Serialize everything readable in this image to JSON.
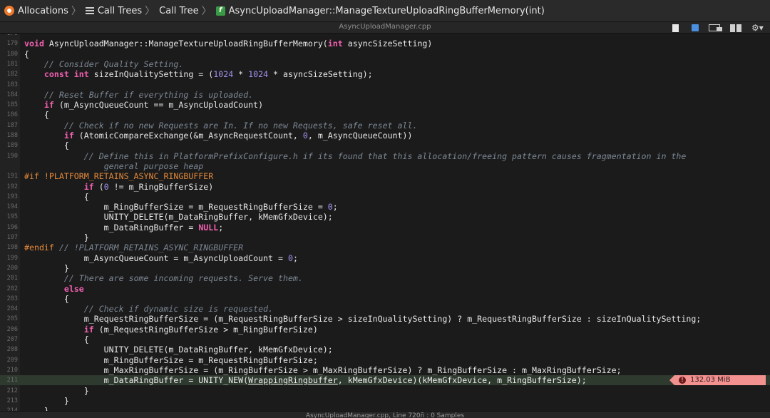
{
  "breadcrumbs": [
    {
      "label": "Allocations",
      "icon": "allocations-icon"
    },
    {
      "label": "Call Trees",
      "icon": "list-icon"
    },
    {
      "label": "Call Tree",
      "icon": ""
    },
    {
      "label": "AsyncUploadManager::ManageTextureUploadRingBufferMemory(int)",
      "icon": "function-icon"
    }
  ],
  "toolbar": {
    "filename": "AsyncUploadManager.cpp",
    "icons": [
      "document-icon",
      "color-picker-icon",
      "window-icon",
      "split-view-icon",
      "gear-icon"
    ]
  },
  "code": {
    "highlight_color": "#2f3a2e",
    "lines": [
      {
        "n": "178",
        "tokens": []
      },
      {
        "n": "179",
        "tokens": [
          [
            "kw",
            "void"
          ],
          [
            "t",
            " AsyncUploadManager::ManageTextureUploadRingBufferMemory("
          ],
          [
            "kw",
            "int"
          ],
          [
            "t",
            " asyncSizeSetting)"
          ]
        ]
      },
      {
        "n": "180",
        "tokens": [
          [
            "t",
            "{"
          ]
        ]
      },
      {
        "n": "181",
        "tokens": [
          [
            "t",
            "    "
          ],
          [
            "cm",
            "// Consider Quality Setting."
          ]
        ]
      },
      {
        "n": "182",
        "tokens": [
          [
            "t",
            "    "
          ],
          [
            "kw",
            "const int"
          ],
          [
            "t",
            " sizeInQualitySetting = ("
          ],
          [
            "num",
            "1024"
          ],
          [
            "t",
            " * "
          ],
          [
            "num",
            "1024"
          ],
          [
            "t",
            " * asyncSizeSetting);"
          ]
        ]
      },
      {
        "n": "183",
        "tokens": []
      },
      {
        "n": "184",
        "tokens": [
          [
            "t",
            "    "
          ],
          [
            "cm",
            "// Reset Buffer if everything is uploaded."
          ]
        ]
      },
      {
        "n": "185",
        "tokens": [
          [
            "t",
            "    "
          ],
          [
            "kw",
            "if"
          ],
          [
            "t",
            " (m_AsyncQueueCount == m_AsyncUploadCount)"
          ]
        ]
      },
      {
        "n": "186",
        "tokens": [
          [
            "t",
            "    {"
          ]
        ]
      },
      {
        "n": "187",
        "tokens": [
          [
            "t",
            "        "
          ],
          [
            "cm",
            "// Check if no new Requests are In. If no new Requests, safe reset all."
          ]
        ]
      },
      {
        "n": "188",
        "tokens": [
          [
            "t",
            "        "
          ],
          [
            "kw",
            "if"
          ],
          [
            "t",
            " (AtomicCompareExchange(&m_AsyncRequestCount, "
          ],
          [
            "num",
            "0"
          ],
          [
            "t",
            ", m_AsyncQueueCount))"
          ]
        ]
      },
      {
        "n": "189",
        "tokens": [
          [
            "t",
            "        {"
          ]
        ]
      },
      {
        "n": "190",
        "tokens": [
          [
            "t",
            "            "
          ],
          [
            "cm",
            "// Define this in PlatformPrefixConfigure.h if its found that this allocation/freeing pattern causes fragmentation in the"
          ]
        ]
      },
      {
        "n": "",
        "tokens": [
          [
            "t",
            "                "
          ],
          [
            "cm",
            "general purpose heap"
          ]
        ]
      },
      {
        "n": "191",
        "tokens": [
          [
            "pp",
            "#if !PLATFORM_RETAINS_ASYNC_RINGBUFFER"
          ]
        ]
      },
      {
        "n": "192",
        "tokens": [
          [
            "t",
            "            "
          ],
          [
            "kw",
            "if"
          ],
          [
            "t",
            " ("
          ],
          [
            "num",
            "0"
          ],
          [
            "t",
            " != m_RingBufferSize)"
          ]
        ]
      },
      {
        "n": "193",
        "tokens": [
          [
            "t",
            "            {"
          ]
        ]
      },
      {
        "n": "194",
        "tokens": [
          [
            "t",
            "                m_RingBufferSize = m_RequestRingBufferSize = "
          ],
          [
            "num",
            "0"
          ],
          [
            "t",
            ";"
          ]
        ]
      },
      {
        "n": "195",
        "tokens": [
          [
            "t",
            "                UNITY_DELETE(m_DataRingBuffer, kMemGfxDevice);"
          ]
        ]
      },
      {
        "n": "196",
        "tokens": [
          [
            "t",
            "                m_DataRingBuffer = "
          ],
          [
            "kw",
            "NULL"
          ],
          [
            "t",
            ";"
          ]
        ]
      },
      {
        "n": "197",
        "tokens": [
          [
            "t",
            "            }"
          ]
        ]
      },
      {
        "n": "198",
        "tokens": [
          [
            "pp",
            "#endif"
          ],
          [
            "t",
            " "
          ],
          [
            "cm",
            "// !PLATFORM_RETAINS_ASYNC_RINGBUFFER"
          ]
        ]
      },
      {
        "n": "199",
        "tokens": [
          [
            "t",
            "            m_AsyncQueueCount = m_AsyncUploadCount = "
          ],
          [
            "num",
            "0"
          ],
          [
            "t",
            ";"
          ]
        ]
      },
      {
        "n": "200",
        "tokens": [
          [
            "t",
            "        }"
          ]
        ]
      },
      {
        "n": "201",
        "tokens": [
          [
            "t",
            "        "
          ],
          [
            "cm",
            "// There are some incoming requests. Serve them."
          ]
        ]
      },
      {
        "n": "202",
        "tokens": [
          [
            "t",
            "        "
          ],
          [
            "kw",
            "else"
          ]
        ]
      },
      {
        "n": "203",
        "tokens": [
          [
            "t",
            "        {"
          ]
        ]
      },
      {
        "n": "204",
        "tokens": [
          [
            "t",
            "            "
          ],
          [
            "cm",
            "// Check if dynamic size is requested."
          ]
        ]
      },
      {
        "n": "205",
        "tokens": [
          [
            "t",
            "            m_RequestRingBufferSize = (m_RequestRingBufferSize > sizeInQualitySetting) ? m_RequestRingBufferSize : sizeInQualitySetting;"
          ]
        ]
      },
      {
        "n": "206",
        "tokens": [
          [
            "t",
            "            "
          ],
          [
            "kw",
            "if"
          ],
          [
            "t",
            " (m_RequestRingBufferSize > m_RingBufferSize)"
          ]
        ]
      },
      {
        "n": "207",
        "tokens": [
          [
            "t",
            "            {"
          ]
        ]
      },
      {
        "n": "208",
        "tokens": [
          [
            "t",
            "                UNITY_DELETE(m_DataRingBuffer, kMemGfxDevice);"
          ]
        ]
      },
      {
        "n": "209",
        "tokens": [
          [
            "t",
            "                m_RingBufferSize = m_RequestRingBufferSize;"
          ]
        ]
      },
      {
        "n": "210",
        "tokens": [
          [
            "t",
            "                m_MaxRingBufferSize = (m_RingBufferSize > m_MaxRingBufferSize) ? m_RingBufferSize : m_MaxRingBufferSize;"
          ]
        ]
      },
      {
        "n": "211",
        "highlight": true,
        "badge": "132.03 MiB",
        "tokens": [
          [
            "t",
            "                m_DataRingBuffer = UNITY_NEW("
          ],
          [
            "ul",
            "WrappingRingbuffer"
          ],
          [
            "t",
            ", kMemGfxDevice)(kMemGfxDevice, m_RingBufferSize);"
          ]
        ]
      },
      {
        "n": "212",
        "tokens": [
          [
            "t",
            "            }"
          ]
        ]
      },
      {
        "n": "213",
        "tokens": [
          [
            "t",
            "        }"
          ]
        ]
      },
      {
        "n": "214",
        "tokens": [
          [
            "t",
            "    }"
          ]
        ]
      }
    ]
  },
  "statusbar": {
    "text": "AsyncUploadManager.cpp, Line 720ñ : 0 Samples"
  }
}
